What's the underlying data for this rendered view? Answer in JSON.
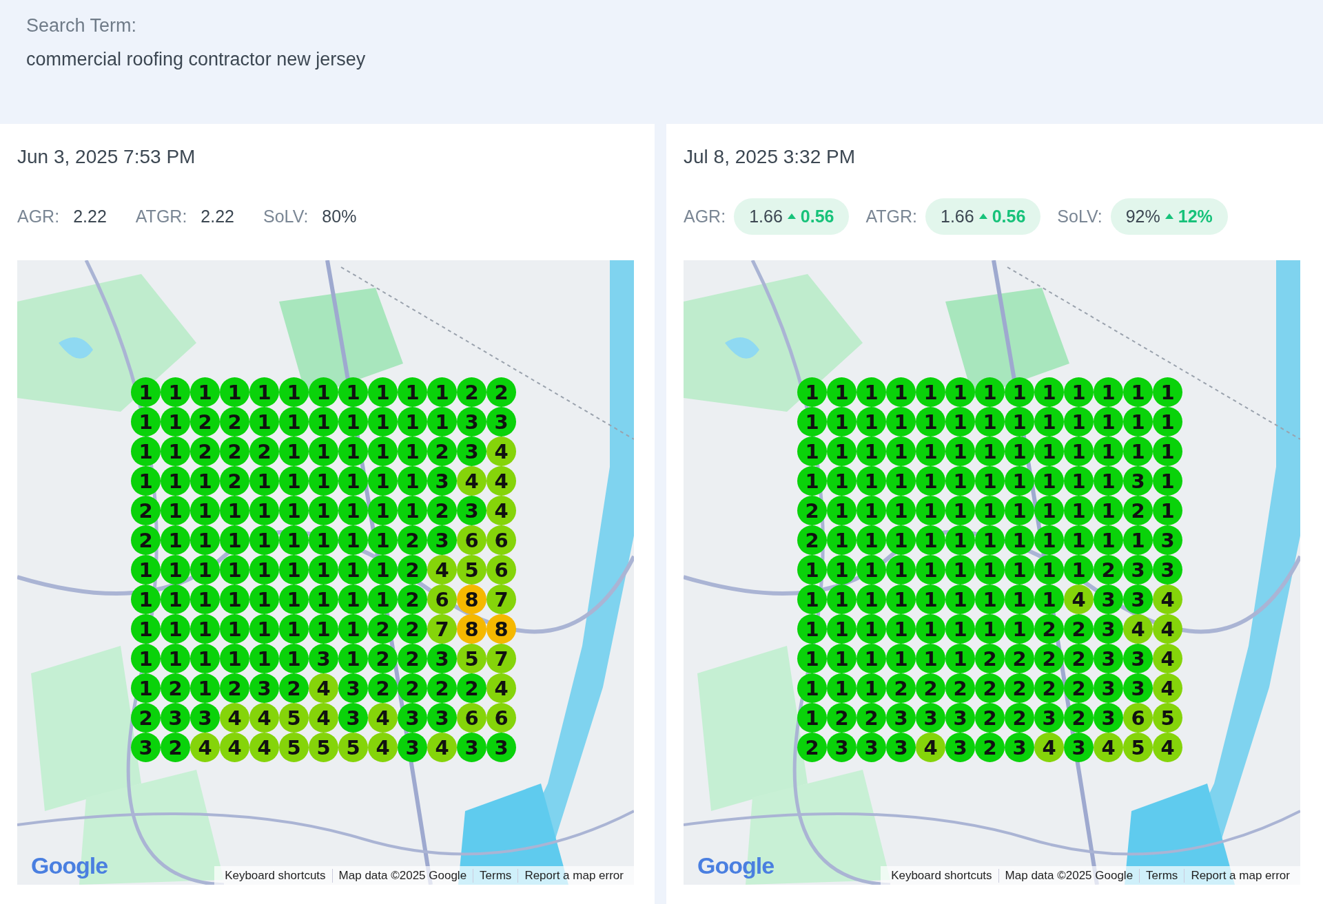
{
  "search": {
    "label": "Search Term:",
    "term": "commercial roofing contractor new jersey"
  },
  "snapshots": [
    {
      "date": "Jun 3, 2025 7:53 PM",
      "metrics": [
        {
          "label": "AGR:",
          "value": "2.22"
        },
        {
          "label": "ATGR:",
          "value": "2.22"
        },
        {
          "label": "SoLV:",
          "value": "80%"
        }
      ],
      "map": {
        "grid": [
          [
            "1",
            "1",
            "1",
            "1",
            "1",
            "1",
            "1",
            "1",
            "1",
            "1",
            "1",
            "2",
            "2"
          ],
          [
            "1",
            "1",
            "2",
            "2",
            "1",
            "1",
            "1",
            "1",
            "1",
            "1",
            "1",
            "3",
            "3"
          ],
          [
            "1",
            "1",
            "2",
            "2",
            "2",
            "1",
            "1",
            "1",
            "1",
            "1",
            "2",
            "3",
            "4"
          ],
          [
            "1",
            "1",
            "1",
            "2",
            "1",
            "1",
            "1",
            "1",
            "1",
            "1",
            "3",
            "4",
            "4"
          ],
          [
            "2",
            "1",
            "1",
            "1",
            "1",
            "1",
            "1",
            "1",
            "1",
            "1",
            "2",
            "3",
            "4"
          ],
          [
            "2",
            "1",
            "1",
            "1",
            "1",
            "1",
            "1",
            "1",
            "1",
            "2",
            "3",
            "6",
            "6"
          ],
          [
            "1",
            "1",
            "1",
            "1",
            "1",
            "1",
            "1",
            "1",
            "1",
            "2",
            "4",
            "5",
            "6"
          ],
          [
            "1",
            "1",
            "1",
            "1",
            "1",
            "1",
            "1",
            "1",
            "1",
            "2",
            "6",
            "8",
            "7"
          ],
          [
            "1",
            "1",
            "1",
            "1",
            "1",
            "1",
            "1",
            "1",
            "2",
            "2",
            "7",
            "8",
            "8"
          ],
          [
            "1",
            "1",
            "1",
            "1",
            "1",
            "1",
            "3",
            "1",
            "2",
            "2",
            "3",
            "5",
            "7"
          ],
          [
            "1",
            "2",
            "1",
            "2",
            "3",
            "2",
            "4",
            "3",
            "2",
            "2",
            "2",
            "2",
            "4"
          ],
          [
            "2",
            "3",
            "3",
            "4",
            "4",
            "5",
            "4",
            "3",
            "4",
            "3",
            "3",
            "6",
            "6"
          ],
          [
            "3",
            "2",
            "4",
            "4",
            "4",
            "5",
            "5",
            "5",
            "4",
            "3",
            "4",
            "3",
            "3"
          ]
        ],
        "logo": "Google",
        "attribution": [
          "Keyboard shortcuts",
          "Map data ©2025 Google",
          "Terms",
          "Report a map error"
        ]
      }
    },
    {
      "date": "Jul 8, 2025 3:32 PM",
      "metrics": [
        {
          "label": "AGR:",
          "value": "1.66",
          "delta": "0.56"
        },
        {
          "label": "ATGR:",
          "value": "1.66",
          "delta": "0.56"
        },
        {
          "label": "SoLV:",
          "value": "92%",
          "delta": "12%"
        }
      ],
      "map": {
        "grid": [
          [
            "1",
            "1",
            "1",
            "1",
            "1",
            "1",
            "1",
            "1",
            "1",
            "1",
            "1",
            "1",
            "1"
          ],
          [
            "1",
            "1",
            "1",
            "1",
            "1",
            "1",
            "1",
            "1",
            "1",
            "1",
            "1",
            "1",
            "1"
          ],
          [
            "1",
            "1",
            "1",
            "1",
            "1",
            "1",
            "1",
            "1",
            "1",
            "1",
            "1",
            "1",
            "1"
          ],
          [
            "1",
            "1",
            "1",
            "1",
            "1",
            "1",
            "1",
            "1",
            "1",
            "1",
            "1",
            "3",
            "1"
          ],
          [
            "2",
            "1",
            "1",
            "1",
            "1",
            "1",
            "1",
            "1",
            "1",
            "1",
            "1",
            "2",
            "1"
          ],
          [
            "2",
            "1",
            "1",
            "1",
            "1",
            "1",
            "1",
            "1",
            "1",
            "1",
            "1",
            "1",
            "3"
          ],
          [
            "1",
            "1",
            "1",
            "1",
            "1",
            "1",
            "1",
            "1",
            "1",
            "1",
            "2",
            "3",
            "3"
          ],
          [
            "1",
            "1",
            "1",
            "1",
            "1",
            "1",
            "1",
            "1",
            "1",
            "4",
            "3",
            "3",
            "4"
          ],
          [
            "1",
            "1",
            "1",
            "1",
            "1",
            "1",
            "1",
            "1",
            "2",
            "2",
            "3",
            "4",
            "4"
          ],
          [
            "1",
            "1",
            "1",
            "1",
            "1",
            "1",
            "2",
            "2",
            "2",
            "2",
            "3",
            "3",
            "4"
          ],
          [
            "1",
            "1",
            "1",
            "2",
            "2",
            "2",
            "2",
            "2",
            "2",
            "2",
            "3",
            "3",
            "4"
          ],
          [
            "1",
            "2",
            "2",
            "3",
            "3",
            "3",
            "2",
            "2",
            "3",
            "2",
            "3",
            "6",
            "5"
          ],
          [
            "2",
            "3",
            "3",
            "3",
            "4",
            "3",
            "2",
            "3",
            "4",
            "3",
            "4",
            "5",
            "4"
          ]
        ],
        "logo": "Google",
        "attribution": [
          "Keyboard shortcuts",
          "Map data ©2025 Google",
          "Terms",
          "Report a map error"
        ]
      }
    }
  ]
}
